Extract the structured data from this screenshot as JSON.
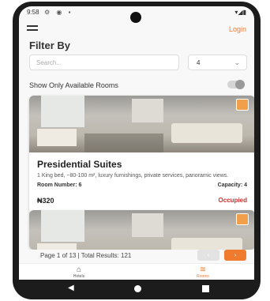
{
  "status_bar": {
    "time": "9:58",
    "icons": "⚙ ◉ ▪",
    "right": "▾◢▮"
  },
  "header": {
    "login_label": "Login",
    "title": "Filter By"
  },
  "filters": {
    "search_placeholder": "Search...",
    "search_value": "",
    "select_value": "4",
    "available_label": "Show Only Available Rooms",
    "available_on": false
  },
  "rooms": [
    {
      "name": "Presidential Suites",
      "description": "1 King bed, ~80-100 m², luxury furnishings, private services, panoramic views.",
      "room_number_label": "Room Number: 6",
      "capacity_label": "Capacity: 4",
      "price": "₦320",
      "status": "Occupied"
    }
  ],
  "pagination": {
    "text": "Page 1 of 13 | Total Results: 121",
    "prev_label": "‹",
    "next_label": "›"
  },
  "bottom_nav": {
    "hotels_label": "Hotels",
    "hotels_icon": "⌂",
    "rooms_label": "Rooms",
    "rooms_icon": "≋"
  },
  "colors": {
    "accent": "#f07a2e",
    "occupied": "#d32f2f"
  }
}
